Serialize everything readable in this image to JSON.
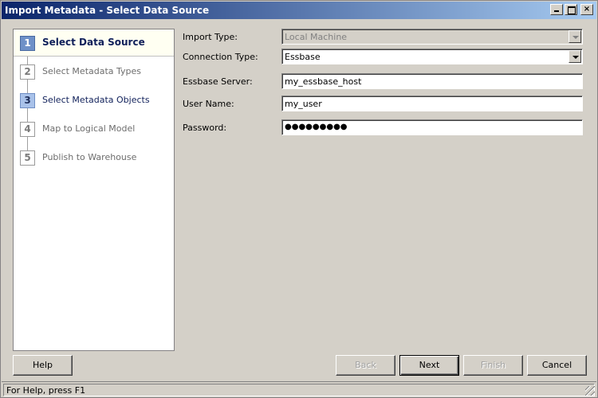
{
  "window": {
    "title": "Import Metadata - Select Data Source"
  },
  "steps": [
    {
      "number": "1",
      "label": "Select Data Source",
      "state": "current"
    },
    {
      "number": "2",
      "label": "Select Metadata Types",
      "state": "pending"
    },
    {
      "number": "3",
      "label": "Select Metadata Objects",
      "state": "done"
    },
    {
      "number": "4",
      "label": "Map to Logical Model",
      "state": "pending"
    },
    {
      "number": "5",
      "label": "Publish to Warehouse",
      "state": "pending"
    }
  ],
  "form": {
    "import_type": {
      "label": "Import Type:",
      "value": "Local Machine"
    },
    "connection_type": {
      "label": "Connection Type:",
      "value": "Essbase"
    },
    "essbase_server": {
      "label": "Essbase Server:",
      "value": "my_essbase_host"
    },
    "user_name": {
      "label": "User Name:",
      "value": "my_user"
    },
    "password": {
      "label": "Password:",
      "value": "●●●●●●●●●"
    }
  },
  "buttons": {
    "help": "Help",
    "back": "Back",
    "next": "Next",
    "finish": "Finish",
    "cancel": "Cancel"
  },
  "status": {
    "text": "For Help, press F1"
  },
  "icons": {
    "minimize": "minimize-icon",
    "maximize": "maximize-icon",
    "close": "close-icon",
    "dropdown": "chevron-down-icon"
  },
  "colors": {
    "title_start": "#0a246a",
    "title_end": "#a6caf0",
    "step_current": "#6f91c8",
    "step_done": "#a9c2ea"
  }
}
